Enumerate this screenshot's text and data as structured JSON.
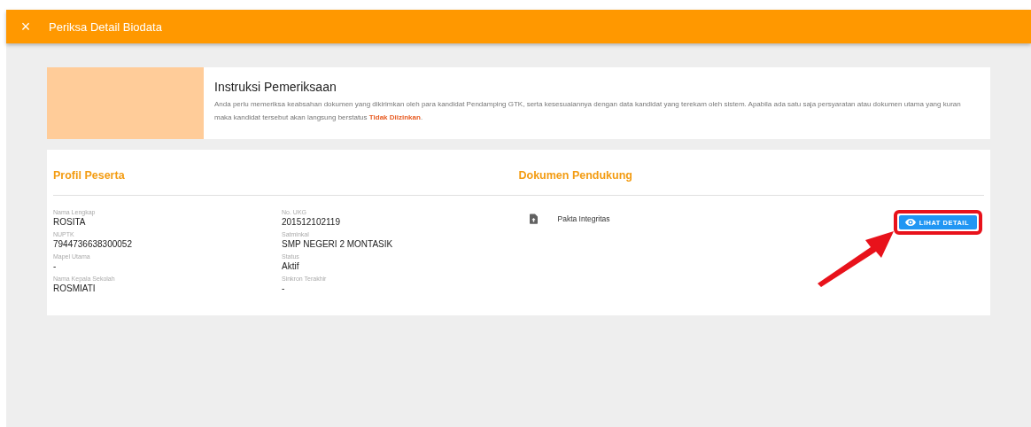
{
  "header": {
    "close": "×",
    "title": "Periksa Detail Biodata"
  },
  "instructions": {
    "title": "Instruksi Pemeriksaan",
    "text": "Anda perlu memeriksa keabsahan dokumen yang dikirimkan oleh para kandidat Pendamping GTK, serta kesesuaiannya dengan data kandidat yang terekam oleh sistem. Apabila ada satu saja persyaratan atau dokumen utama yang kuran maka kandidat tersebut akan langsung berstatus **Tidak Diizinkan**."
  },
  "profile": {
    "title": "Profil Peserta",
    "columns": [
      [
        {
          "label": "Nama Lengkap",
          "value": "ROSITA"
        },
        {
          "label": "NUPTK",
          "value": "7944736638300052"
        },
        {
          "label": "Mapel Utama",
          "value": "-"
        },
        {
          "label": "Nama Kepala Sekolah",
          "value": "ROSMIATI"
        }
      ],
      [
        {
          "label": "No. UKG",
          "value": "201512102119"
        },
        {
          "label": "Satminkal",
          "value": "SMP NEGERI 2 MONTASIK"
        },
        {
          "label": "Status",
          "value": "Aktif"
        },
        {
          "label": "Sinkron Terakhir",
          "value": "-"
        }
      ]
    ]
  },
  "documents": {
    "title": "Dokumen Pendukung",
    "items": [
      {
        "name": "Pakta Integritas",
        "button": "LIHAT DETAIL",
        "highlighted": true
      }
    ]
  }
}
